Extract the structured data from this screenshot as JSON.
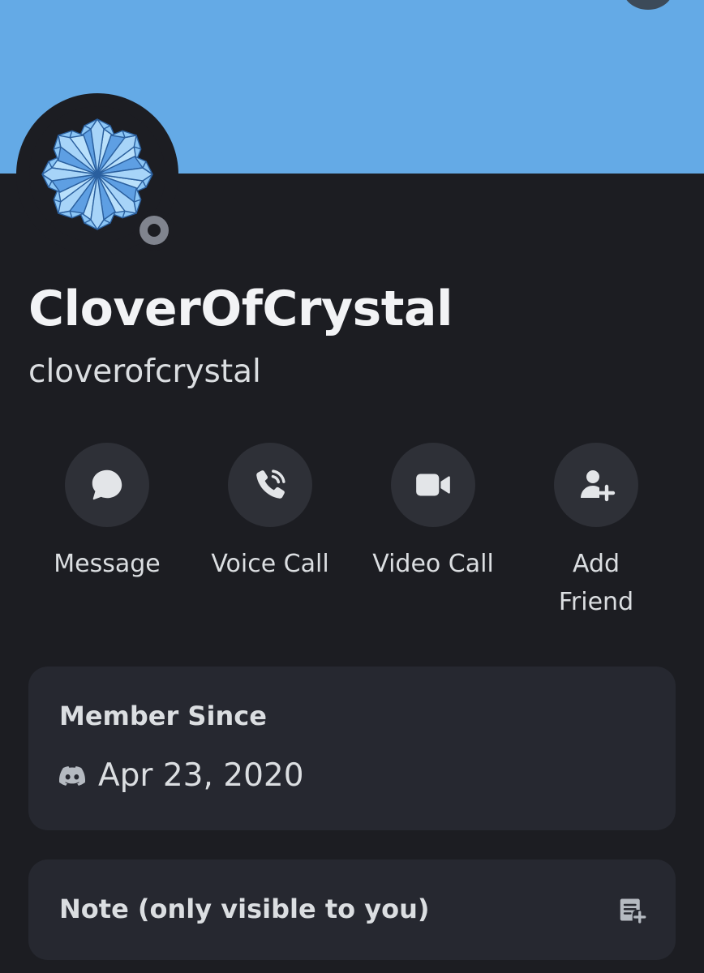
{
  "profile": {
    "display_name": "CloverOfCrystal",
    "username": "cloverofcrystal",
    "status": "offline"
  },
  "actions": [
    {
      "label": "Message",
      "icon": "chat-bubble-icon"
    },
    {
      "label": "Voice Call",
      "icon": "phone-icon"
    },
    {
      "label": "Video Call",
      "icon": "video-camera-icon"
    },
    {
      "label": "Add Friend",
      "icon": "add-friend-icon"
    }
  ],
  "member_since": {
    "title": "Member Since",
    "date": "Apr 23, 2020",
    "icon": "discord-icon"
  },
  "note": {
    "title": "Note (only visible to you)",
    "icon": "add-note-icon"
  },
  "colors": {
    "banner": "#64aae6",
    "background": "#1c1d22",
    "card": "#262830",
    "button": "#2e3037",
    "status_offline": "#80848e"
  }
}
